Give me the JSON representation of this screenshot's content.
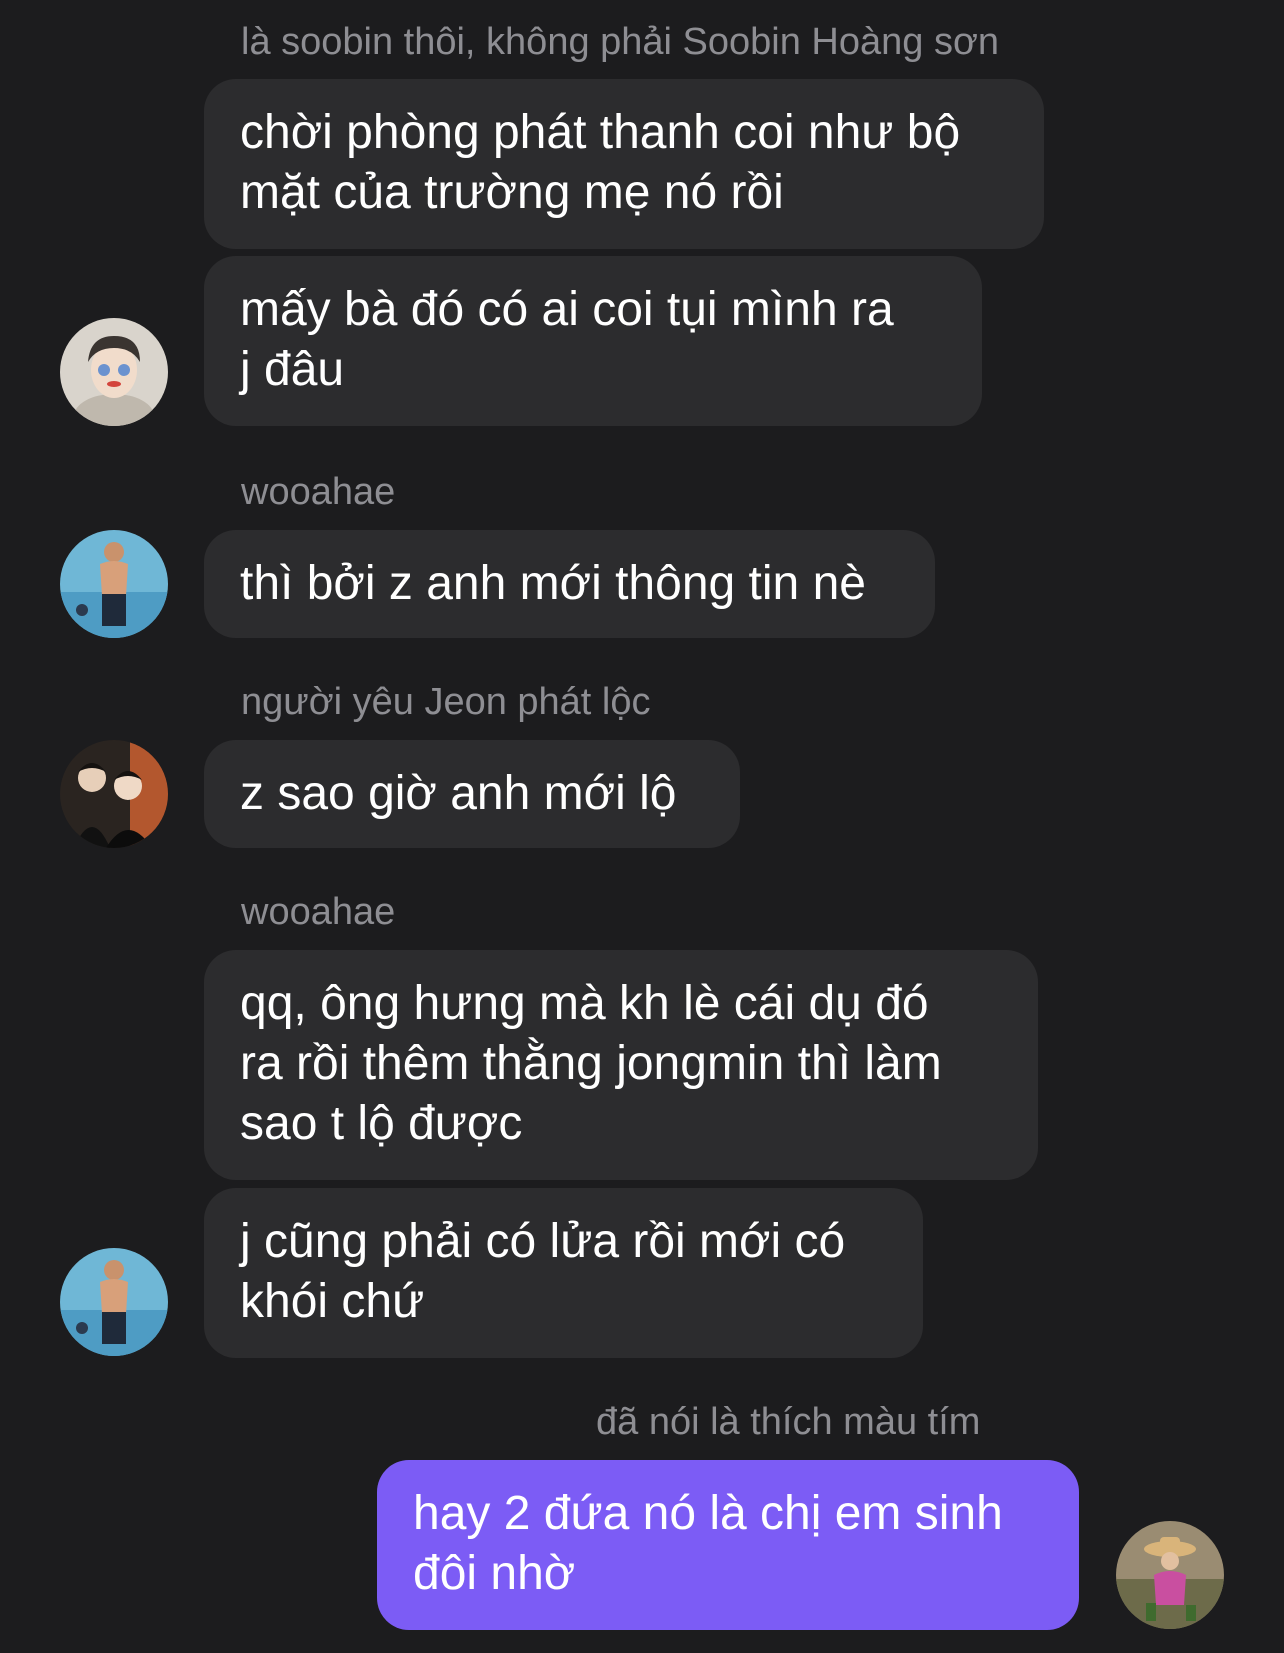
{
  "messages": [
    {
      "sender": "là soobin thôi, không phải Soobin Hoàng sơn",
      "bubbles": [
        {
          "lines": [
            "chời phòng phát thanh coi như bộ",
            "mặt của trường mẹ nó rồi"
          ]
        },
        {
          "lines": [
            "mấy bà đó có ai coi tụi mình ra",
            "j đâu"
          ]
        }
      ]
    },
    {
      "sender": "wooahae",
      "bubbles": [
        {
          "lines": [
            "thì bởi z anh mới thông tin nè"
          ]
        }
      ]
    },
    {
      "sender": "người yêu Jeon phát lộc",
      "bubbles": [
        {
          "lines": [
            "z sao giờ anh mới lộ"
          ]
        }
      ]
    },
    {
      "sender": "wooahae",
      "bubbles": [
        {
          "lines": [
            "qq, ông hưng mà kh lè cái dụ đó",
            "ra rồi thêm thằng jongmin thì làm",
            "sao t lộ được"
          ]
        },
        {
          "lines": [
            "j cũng phải có lửa rồi mới có",
            "khói chứ"
          ]
        }
      ]
    },
    {
      "sender": "đã nói là thích màu tím",
      "bubbles": [
        {
          "lines": [
            "hay 2 đứa nó là chị em sinh",
            "đôi nhờ"
          ]
        }
      ]
    }
  ],
  "theme": {
    "background": "#1c1c1e",
    "incoming_bubble": "#2c2c2e",
    "outgoing_bubble": "#7c5cf5",
    "sender_text": "#8e8e93"
  },
  "avatars": [
    "avatar-soobin",
    "avatar-wooahae",
    "avatar-jeon",
    "avatar-wooahae",
    "avatar-me"
  ]
}
